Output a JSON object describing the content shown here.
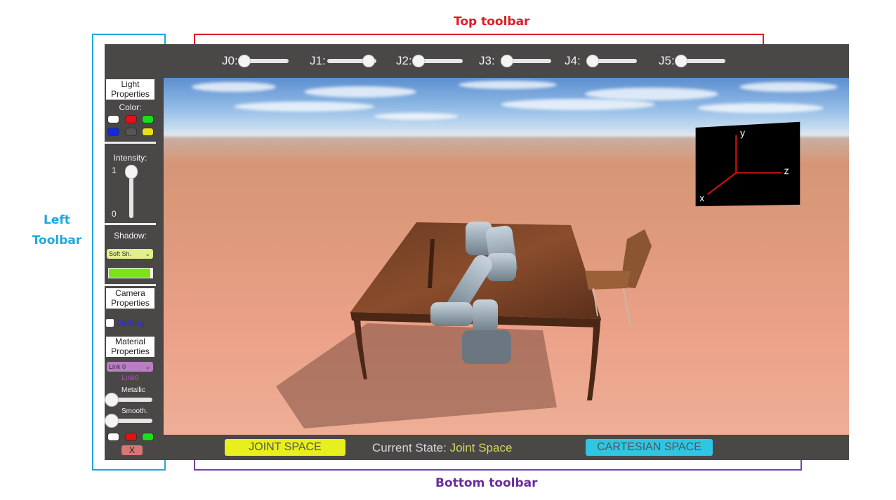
{
  "annotations": {
    "top_toolbar": "Top toolbar",
    "bottom_toolbar": "Bottom toolbar",
    "left_toolbar_line1": "Left",
    "left_toolbar_line2": "Toolbar"
  },
  "top_toolbar": {
    "joints": [
      {
        "label": "J0:",
        "value": 0.0
      },
      {
        "label": "J1:",
        "value": 1.0
      },
      {
        "label": "J2:",
        "value": 0.0
      },
      {
        "label": "J3:",
        "value": 0.0
      },
      {
        "label": "J4:",
        "value": 0.0
      },
      {
        "label": "J5:",
        "value": 0.0
      }
    ]
  },
  "left_toolbar": {
    "light_header_line1": "Light",
    "light_header_line2": "Properties",
    "color_label": "Color:",
    "light_colors": [
      "#ffffff",
      "#e51010",
      "#1adf1a",
      "#1428e0",
      "#555555",
      "#e6e018"
    ],
    "intensity_label": "Intensity:",
    "intensity_max": "1",
    "intensity_min": "0",
    "intensity_value": 1.0,
    "shadow_label": "Shadow:",
    "shadow_option": "Soft Sh.",
    "shadow_strength": 1.0,
    "camera_header_line1": "Camera",
    "camera_header_line2": "Properties",
    "ortho_label": "Orthog.",
    "material_header_line1": "Material",
    "material_header_line2": "Properties",
    "link_option": "Link 0",
    "link_label": "Link0",
    "metallic_label": "Metallic",
    "metallic_value": 0.0,
    "smooth_label": "Smooth.",
    "smooth_value": 0.0,
    "material_colors": [
      "#ffffff",
      "#e51010",
      "#1adf1a"
    ],
    "close_label": "X"
  },
  "bottom_toolbar": {
    "joint_space_label": "JOINT SPACE",
    "state_prefix": "Current State:",
    "state_value": "Joint Space",
    "cartesian_space_label": "CARTESIAN SPACE"
  },
  "gizmo": {
    "x": "x",
    "y": "y",
    "z": "z"
  }
}
